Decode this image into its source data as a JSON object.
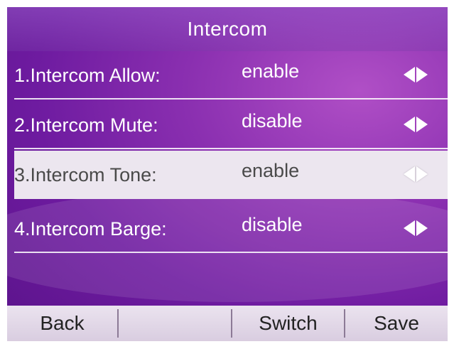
{
  "screen": {
    "title": "Intercom"
  },
  "rows": [
    {
      "label": "1.Intercom Allow:",
      "value": "enable",
      "selected": false
    },
    {
      "label": "2.Intercom Mute:",
      "value": "disable",
      "selected": false
    },
    {
      "label": "3.Intercom Tone:",
      "value": "enable",
      "selected": true
    },
    {
      "label": "4.Intercom Barge:",
      "value": "disable",
      "selected": false
    }
  ],
  "softkeys": {
    "back": "Back",
    "empty": "",
    "switch": "Switch",
    "save": "Save"
  },
  "icons": {
    "left_arrow": "triangle-left-icon",
    "right_arrow": "triangle-right-icon"
  },
  "colors": {
    "background_purple": "#6e1ba0",
    "selected_row": "#ece6ef",
    "softkey_bar": "#e3d9e8"
  }
}
